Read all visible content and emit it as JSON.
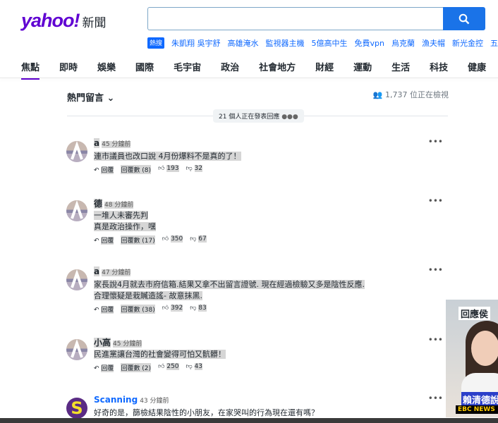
{
  "header": {
    "logo": "yahoo!",
    "logo_suffix": "新聞",
    "search_placeholder": "",
    "trending_label": "熱搜",
    "trending": [
      "朱凱翔 吳宇舒",
      "高雄淹水",
      "監視器主機",
      "5億高中生",
      "免費vpn",
      "烏克蘭",
      "漁夫帽",
      "新光金控",
      "五月"
    ]
  },
  "nav": [
    "焦點",
    "即時",
    "娛樂",
    "國際",
    "毛宇宙",
    "政治",
    "社會地方",
    "財經",
    "運動",
    "生活",
    "科技",
    "健康"
  ],
  "comments_section": {
    "title": "熱門留言",
    "viewers": "1,737 位正在檢視",
    "typing": "21 個人正在發表回應",
    "comments": [
      {
        "name": "a",
        "time": "45 分鐘前",
        "lines": [
          "連市議員也改口說 4月份爆料不是真的了！"
        ],
        "reply": "回覆",
        "replies": "回覆數 (8)",
        "likes": "193",
        "dislikes": "32"
      },
      {
        "name": "德",
        "time": "48 分鐘前",
        "lines": [
          "一堆人未審先判",
          "真是政治操作，嘿"
        ],
        "reply": "回覆",
        "replies": "回覆數 (17)",
        "likes": "350",
        "dislikes": "67"
      },
      {
        "name": "a",
        "time": "47 分鐘前",
        "lines": [
          "家長說4月就去市府信箱.結果又拿不出留言證號. 現在經過檢驗又多是陰性反應.",
          "合理懷疑是栽贓造謠- 故意抹黑."
        ],
        "reply": "回覆",
        "replies": "回覆數 (38)",
        "likes": "392",
        "dislikes": "83"
      },
      {
        "name": "小高",
        "time": "45 分鐘前",
        "lines": [
          "民進黨讓台灣的社會變得可怕又骯髒！"
        ],
        "reply": "回覆",
        "replies": "回覆數 (2)",
        "likes": "250",
        "dislikes": "43"
      },
      {
        "name": "Scanning",
        "time": "43 分鐘前",
        "lines": [
          "好奇的是，篩檢結果陰性的小朋友，在家哭叫的行為現在還有嗎？"
        ]
      }
    ]
  },
  "video": {
    "headline_top": "回應侯",
    "caption": "賴清德說",
    "brand": "EBC NEWS"
  },
  "colors": {
    "brand": "#6001d2",
    "accent": "#1a73e8",
    "link": "#0f69ff"
  }
}
